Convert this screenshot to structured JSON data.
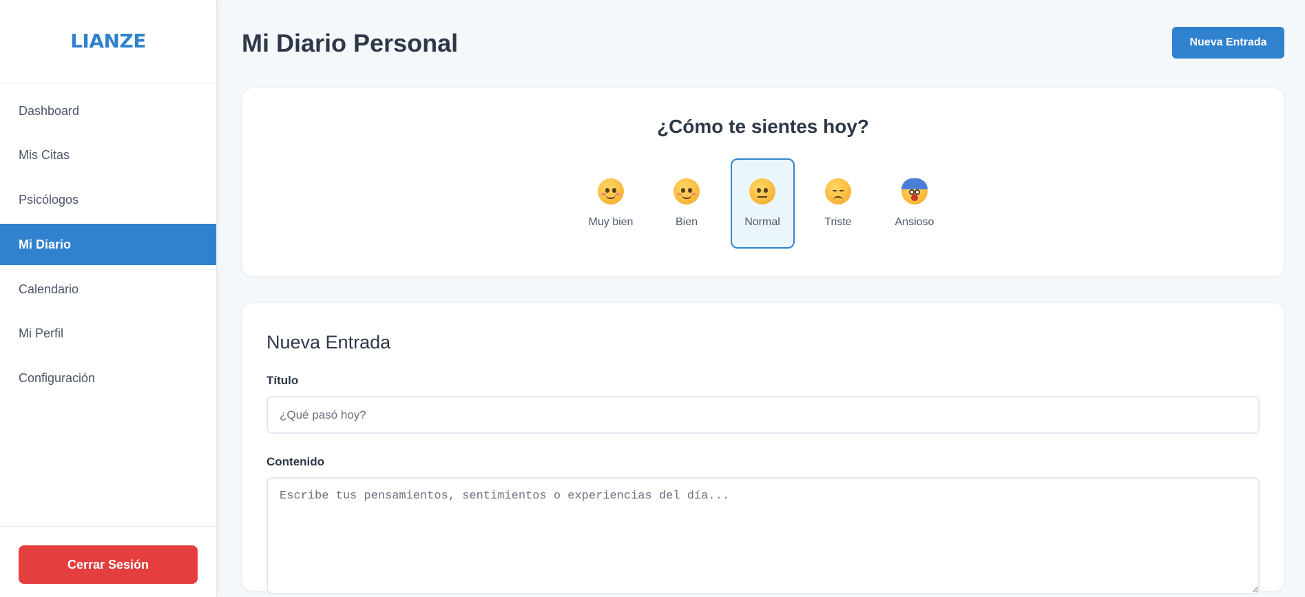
{
  "brand": {
    "name": "LIANZE"
  },
  "sidebar": {
    "items": [
      {
        "label": "Dashboard"
      },
      {
        "label": "Mis Citas"
      },
      {
        "label": "Psicólogos"
      },
      {
        "label": "Mi Diario",
        "active": true
      },
      {
        "label": "Calendario"
      },
      {
        "label": "Mi Perfil"
      },
      {
        "label": "Configuración"
      }
    ],
    "logout_label": "Cerrar Sesión"
  },
  "header": {
    "title": "Mi Diario Personal",
    "new_entry_label": "Nueva Entrada"
  },
  "mood": {
    "question": "¿Cómo te sientes hoy?",
    "selected": "Normal",
    "options": [
      {
        "label": "Muy bien",
        "icon": "smiling-face-icon"
      },
      {
        "label": "Bien",
        "icon": "blushing-face-icon"
      },
      {
        "label": "Normal",
        "icon": "neutral-face-icon"
      },
      {
        "label": "Triste",
        "icon": "pensive-face-icon"
      },
      {
        "label": "Ansioso",
        "icon": "anxious-face-icon"
      }
    ]
  },
  "entry_form": {
    "heading": "Nueva Entrada",
    "title_label": "Título",
    "title_placeholder": "¿Qué pasó hoy?",
    "title_value": "",
    "content_label": "Contenido",
    "content_placeholder": "Escribe tus pensamientos, sentimientos o experiencias del día...",
    "content_value": ""
  },
  "colors": {
    "accent": "#3182ce",
    "danger": "#e53e3e",
    "selected_bg": "#ebf6fc",
    "page_bg": "#f5f8fb"
  }
}
